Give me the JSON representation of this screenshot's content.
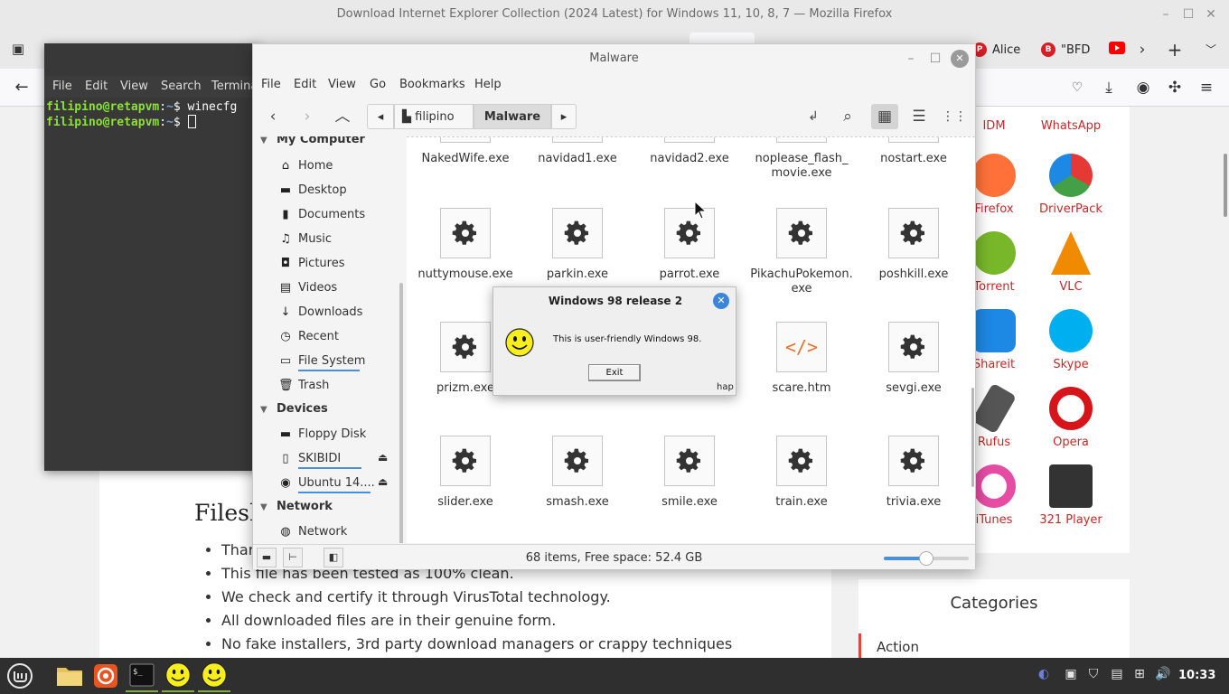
{
  "firefox": {
    "window_title": "Download Internet Explorer Collection (2024 Latest) for Windows 11, 10, 8, 7 — Mozilla Firefox",
    "tabs": [
      {
        "label": "Alice",
        "icon": "pinterest-icon"
      },
      {
        "label": "\"BFD",
        "icon": "bfd-icon"
      }
    ],
    "page": {
      "heading": "Filesh",
      "bullets": [
        "Thar",
        "This file has been tested as 100% clean.",
        "We check and certify it through VirusTotal technology.",
        "All downloaded files are in their genuine form.",
        "No fake installers, 3rd party download managers or crappy techniques"
      ],
      "apps": [
        {
          "label": "IDM",
          "color": "#2c6fb7"
        },
        {
          "label": "WhatsApp",
          "color": "#25d366"
        },
        {
          "label": "Firefox",
          "color": "#ff7139"
        },
        {
          "label": "DriverPack",
          "color": "#2e9e3f"
        },
        {
          "label": "Torrent",
          "color": "#78b72a"
        },
        {
          "label": "VLC",
          "color": "#f08a00"
        },
        {
          "label": "Shareit",
          "color": "#1e88e5"
        },
        {
          "label": "Skype",
          "color": "#00aff0"
        },
        {
          "label": "Rufus",
          "color": "#555555"
        },
        {
          "label": "Opera",
          "color": "#d7141a"
        },
        {
          "label": "iTunes",
          "color": "#e64ca4"
        },
        {
          "label": "321 Player",
          "color": "#333333"
        }
      ],
      "categories_title": "Categories",
      "categories": [
        "Action"
      ]
    }
  },
  "terminal": {
    "menu": [
      "File",
      "Edit",
      "View",
      "Search",
      "Termina"
    ],
    "lines": [
      {
        "user": "filipino@retapvm",
        "path": "~",
        "sym": "$",
        "cmd": " winecfg"
      },
      {
        "user": "filipino@retapvm",
        "path": "~",
        "sym": "$",
        "cmd": " "
      }
    ]
  },
  "nemo": {
    "title": "Malware",
    "menu": [
      "File",
      "Edit",
      "View",
      "Go",
      "Bookmarks",
      "Help"
    ],
    "breadcrumbs": [
      "filipino",
      "Malware"
    ],
    "sidebar": {
      "my_computer": "My Computer",
      "places": [
        "Home",
        "Desktop",
        "Documents",
        "Music",
        "Pictures",
        "Videos",
        "Downloads",
        "Recent",
        "File System",
        "Trash"
      ],
      "devices_header": "Devices",
      "devices": [
        "Floppy Disk",
        "SKIBIDI",
        "Ubuntu 14...."
      ],
      "network_header": "Network",
      "network": [
        "Network"
      ]
    },
    "files_top": [
      "NakedWife.exe",
      "navidad1.exe",
      "navidad2.exe",
      "noplease_flash_ movie.exe",
      "nostart.exe"
    ],
    "files_row2": [
      "nuttymouse.exe",
      "parkin.exe",
      "parrot.exe",
      "PikachuPokemon. exe",
      "poshkill.exe"
    ],
    "files_row3": [
      "prizm.exe",
      "",
      "",
      "scare.htm",
      "sevgi.exe"
    ],
    "files_row4": [
      "slider.exe",
      "smash.exe",
      "smile.exe",
      "train.exe",
      "trivia.exe"
    ],
    "status": "68 items, Free space: 52.4 GB",
    "zoom_level": 0.5
  },
  "dialog": {
    "title": "Windows 98 release 2",
    "message": "This is user-friendly Windows 98.",
    "button": "Exit",
    "footer": "hap"
  },
  "taskbar": {
    "clock": "10:33"
  }
}
